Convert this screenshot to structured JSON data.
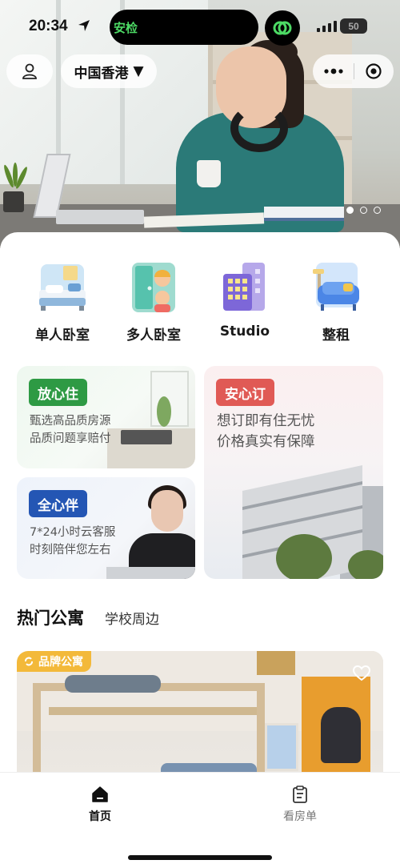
{
  "status_bar": {
    "time": "20:34",
    "island_app": "安检",
    "battery": "50"
  },
  "header": {
    "city": "中国香港",
    "carousel": {
      "count": 3,
      "active": 1
    }
  },
  "categories": [
    {
      "label": "单人卧室",
      "icon": "single-room-icon"
    },
    {
      "label": "多人卧室",
      "icon": "shared-room-icon"
    },
    {
      "label": "Studio",
      "icon": "studio-building-icon"
    },
    {
      "label": "整租",
      "icon": "whole-rent-sofa-icon"
    }
  ],
  "features": {
    "peace_live": {
      "tag": "放心住",
      "line1": "甄选高品质房源",
      "line2": "品质问题享赔付"
    },
    "full_care": {
      "tag": "全心伴",
      "line1": "7*24小时云客服",
      "line2": "时刻陪伴您左右"
    },
    "safe_book": {
      "tag": "安心订",
      "line1": "想订即有住无忧",
      "line2": "价格真实有保障"
    }
  },
  "tabs": [
    {
      "label": "热门公寓",
      "active": true
    },
    {
      "label": "学校周边",
      "active": false
    }
  ],
  "listing": {
    "badge": "品牌公寓"
  },
  "bottom_nav": [
    {
      "label": "首页",
      "icon": "home-icon",
      "active": true
    },
    {
      "label": "看房单",
      "icon": "viewing-list-icon",
      "active": false
    }
  ],
  "colors": {
    "green_tag": "#2e9a44",
    "blue_tag": "#2456b4",
    "red_tag": "#e05a55",
    "brand_badge": "#f3b93a",
    "tab_underline": "#f69e9e"
  }
}
